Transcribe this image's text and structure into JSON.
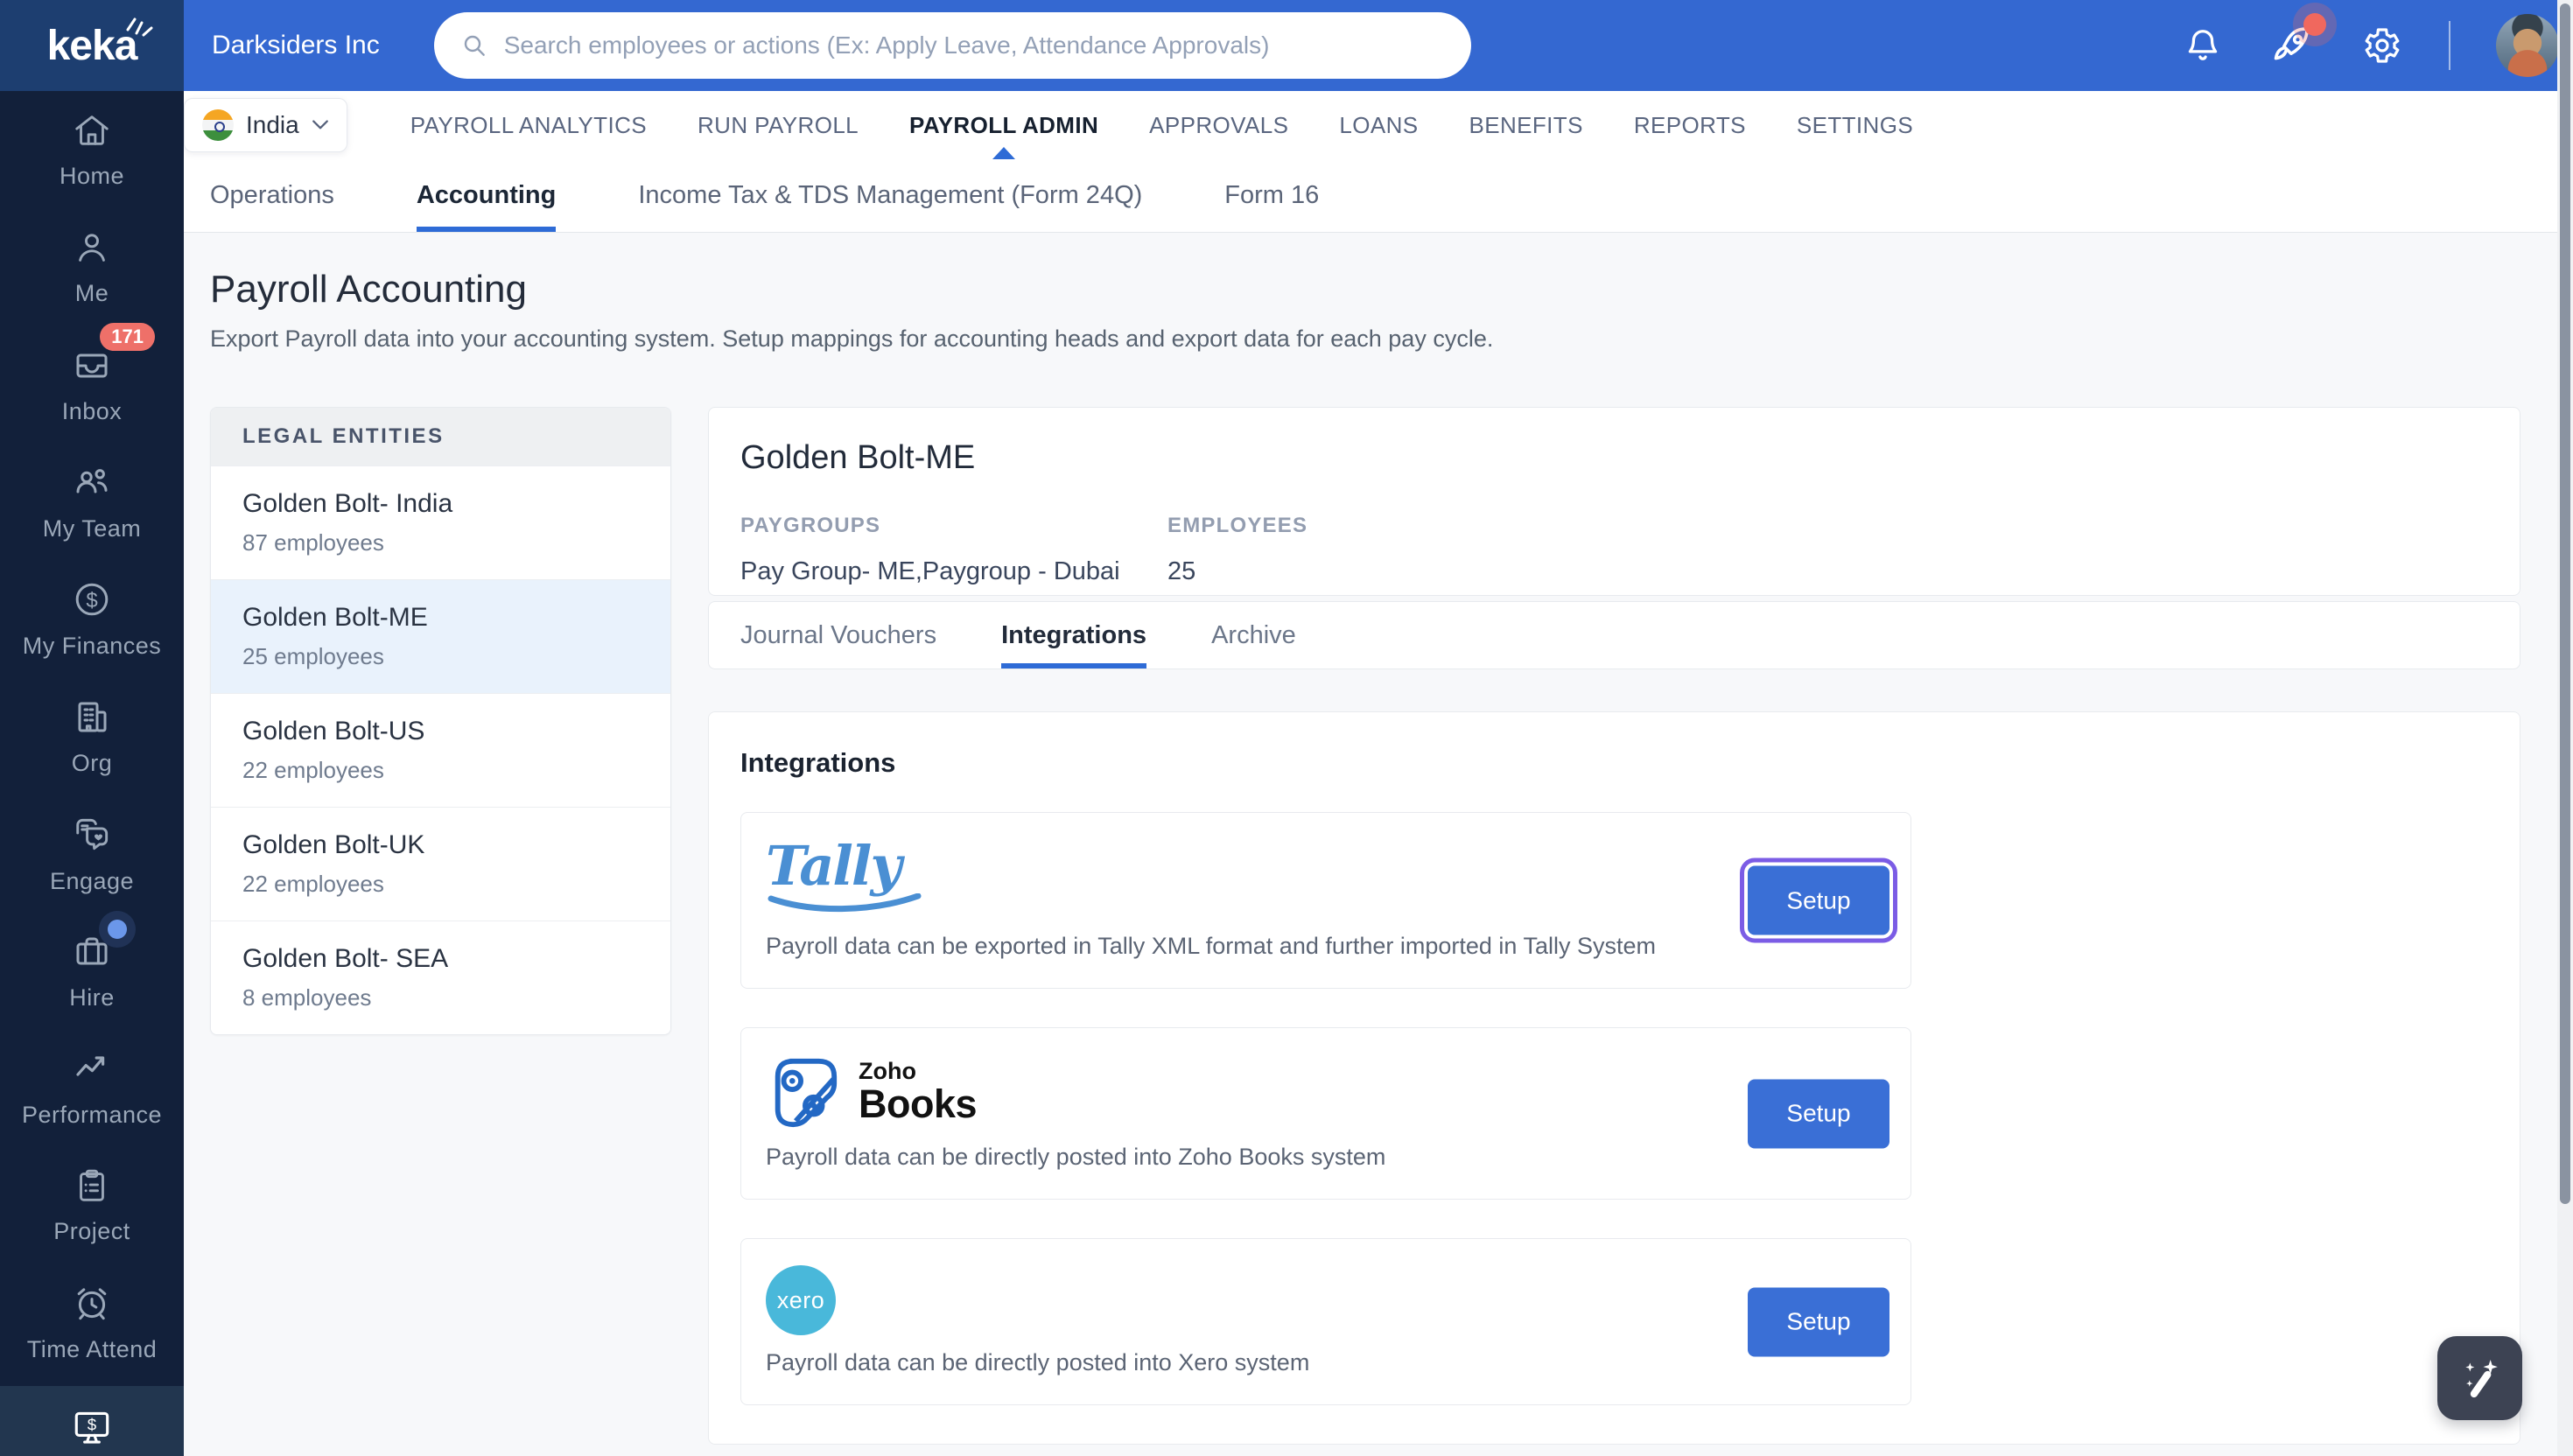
{
  "topbar": {
    "company": "Darksiders Inc",
    "search_placeholder": "Search employees or actions (Ex: Apply Leave, Attendance Approvals)"
  },
  "sidebar": {
    "items": [
      {
        "label": "Home",
        "icon": "home"
      },
      {
        "label": "Me",
        "icon": "person"
      },
      {
        "label": "Inbox",
        "icon": "inbox-tray",
        "badge": "171"
      },
      {
        "label": "My Team",
        "icon": "people-group"
      },
      {
        "label": "My Finances",
        "icon": "dollar-circle"
      },
      {
        "label": "Org",
        "icon": "building"
      },
      {
        "label": "Engage",
        "icon": "chat-bubbles"
      },
      {
        "label": "Hire",
        "icon": "briefcase",
        "notification_dot": true
      },
      {
        "label": "Performance",
        "icon": "trend-arrow"
      },
      {
        "label": "Project",
        "icon": "clipboard"
      },
      {
        "label": "Time Attend",
        "icon": "alarm-clock"
      },
      {
        "icon": "payroll-monitor",
        "active": true
      }
    ]
  },
  "nav": {
    "country": "India",
    "items": [
      {
        "label": "PAYROLL ANALYTICS"
      },
      {
        "label": "RUN PAYROLL"
      },
      {
        "label": "PAYROLL ADMIN",
        "active": true
      },
      {
        "label": "APPROVALS"
      },
      {
        "label": "LOANS"
      },
      {
        "label": "BENEFITS"
      },
      {
        "label": "REPORTS"
      },
      {
        "label": "SETTINGS"
      }
    ]
  },
  "subnav": {
    "tabs": [
      {
        "label": "Operations"
      },
      {
        "label": "Accounting",
        "active": true
      },
      {
        "label": "Income Tax & TDS Management (Form 24Q)"
      },
      {
        "label": "Form 16"
      }
    ]
  },
  "page": {
    "title": "Payroll Accounting",
    "subtitle": "Export Payroll data into your accounting system. Setup mappings for accounting heads and export data for each pay cycle."
  },
  "legal_entities": {
    "header": "LEGAL ENTITIES",
    "items": [
      {
        "name": "Golden Bolt- India",
        "employees": "87 employees"
      },
      {
        "name": "Golden Bolt-ME",
        "employees": "25 employees",
        "selected": true
      },
      {
        "name": "Golden Bolt-US",
        "employees": "22 employees"
      },
      {
        "name": "Golden Bolt-UK",
        "employees": "22 employees"
      },
      {
        "name": "Golden Bolt- SEA",
        "employees": "8 employees"
      }
    ]
  },
  "entity": {
    "name": "Golden Bolt-ME",
    "paygroups_label": "PAYGROUPS",
    "paygroups_value": "Pay Group- ME,Paygroup - Dubai",
    "employees_label": "EMPLOYEES",
    "employees_value": "25",
    "tabs": [
      {
        "label": "Journal Vouchers"
      },
      {
        "label": "Integrations",
        "active": true
      },
      {
        "label": "Archive"
      }
    ]
  },
  "integrations": {
    "heading": "Integrations",
    "cards": [
      {
        "name": "Tally",
        "logo_text": "Tally",
        "description": "Payroll data can be exported in Tally XML format and further imported in Tally System",
        "button_label": "Setup",
        "focused": true
      },
      {
        "name": "Zoho Books",
        "logo_top": "Zoho",
        "logo_bottom": "Books",
        "description": "Payroll data can be directly posted into Zoho Books system",
        "button_label": "Setup"
      },
      {
        "name": "Xero",
        "logo_text": "xero",
        "description": "Payroll data can be directly posted into Xero system",
        "button_label": "Setup"
      }
    ]
  },
  "colors": {
    "header_blue": "#3468d1",
    "logo_navy": "#1d3e70",
    "sidebar_navy": "#12203a",
    "accent_blue": "#2e6bd6",
    "button_blue": "#3a6fd6",
    "badge_red": "#ee7069",
    "focus_purple": "#7b5ce5",
    "tally_blue": "#4a8fd3",
    "xero_teal": "#49b8da",
    "selected_row_blue": "#e9f2fc",
    "page_bg": "#f7f8fa"
  }
}
